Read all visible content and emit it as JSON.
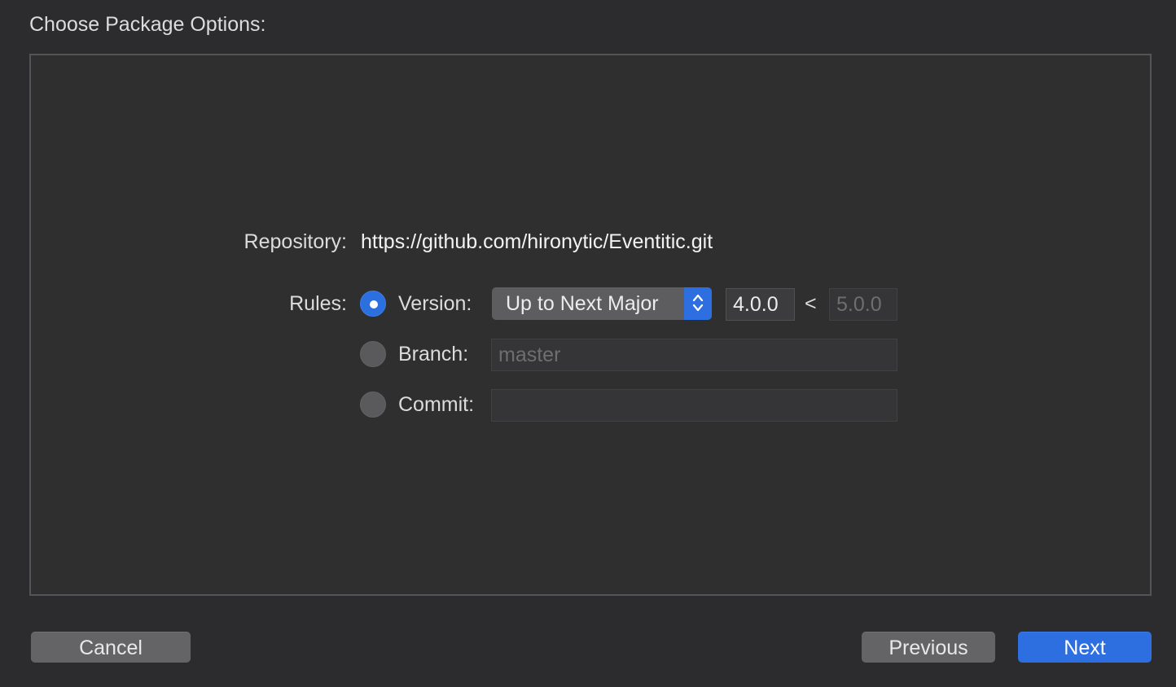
{
  "heading": "Choose Package Options:",
  "repository": {
    "label": "Repository:",
    "url": "https://github.com/hironytic/Eventitic.git"
  },
  "rules": {
    "label": "Rules:",
    "version": {
      "label": "Version:",
      "selected": true,
      "rule_option": "Up to Next Major",
      "stepper_glyph": "⌃⌄",
      "lower": "4.0.0",
      "separator": "<",
      "upper": "5.0.0"
    },
    "branch": {
      "label": "Branch:",
      "selected": false,
      "placeholder": "master",
      "value": ""
    },
    "commit": {
      "label": "Commit:",
      "selected": false,
      "value": ""
    }
  },
  "buttons": {
    "cancel": "Cancel",
    "previous": "Previous",
    "next": "Next"
  },
  "colors": {
    "accent": "#2d6ee0",
    "background": "#2c2c2f",
    "panel": "#2f2f2f"
  }
}
